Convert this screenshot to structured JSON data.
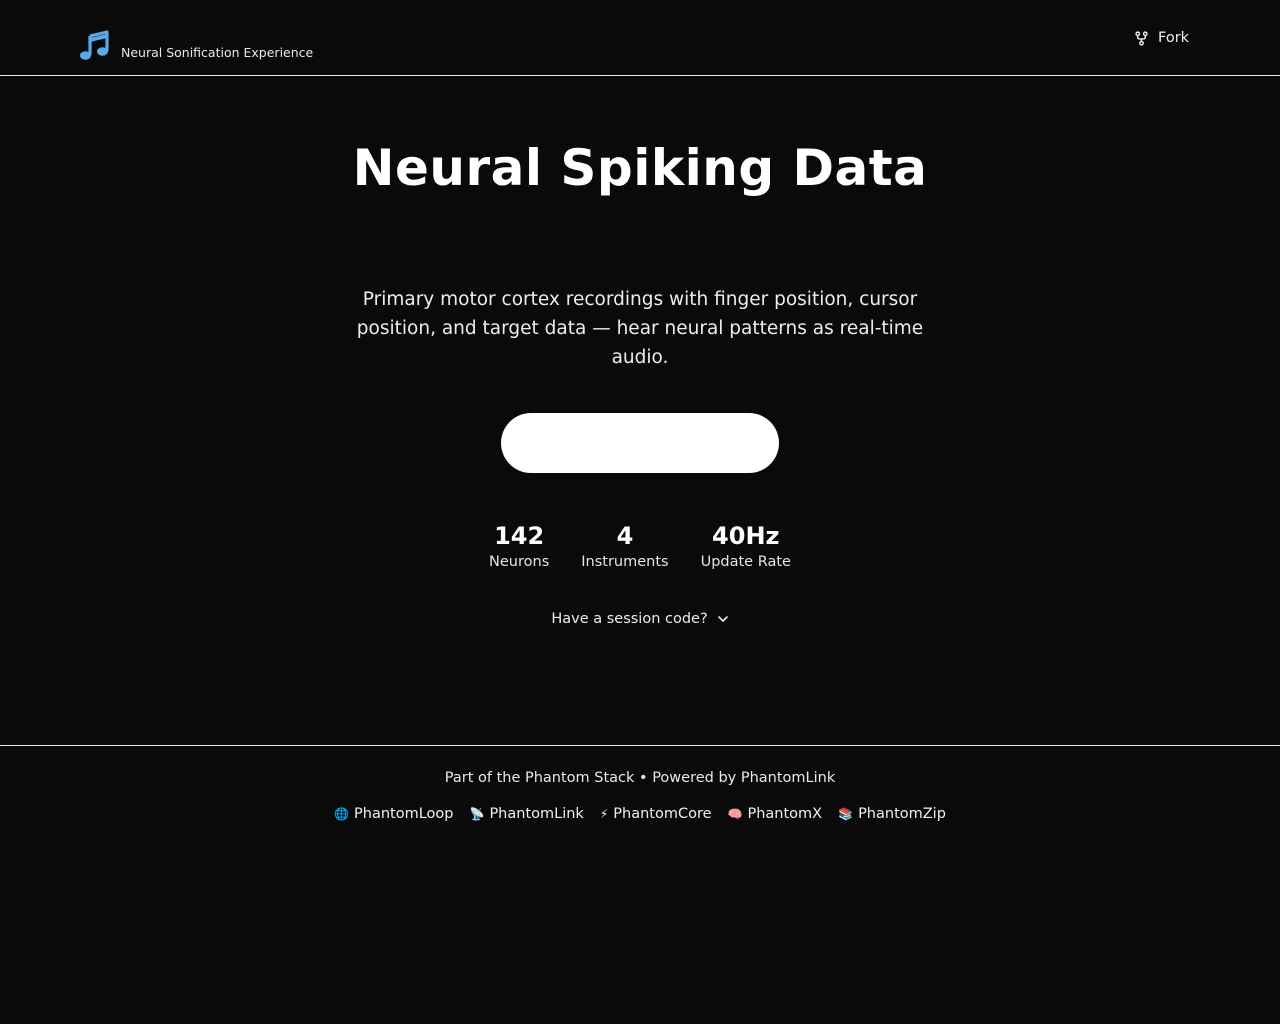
{
  "header": {
    "logo_icon": "music-note-icon",
    "logo_color": "#5aa9e6",
    "tagline": "Neural Sonification Experience",
    "fork_icon": "git-fork-icon",
    "fork_label": "Fork"
  },
  "main": {
    "title": "Neural Spiking Data",
    "description": "Primary motor cortex recordings with finger position, cursor position, and target data — hear neural patterns as real-time audio.",
    "primary_button_label": "",
    "stats": [
      {
        "value": "142",
        "label": "Neurons"
      },
      {
        "value": "4",
        "label": "Instruments"
      },
      {
        "value": "40Hz",
        "label": "Update Rate"
      }
    ],
    "session_toggle_label": "Have a session code?",
    "session_toggle_icon": "chevron-down-icon"
  },
  "footer": {
    "credit_line": "Part of the Phantom Stack • Powered by PhantomLink",
    "links": [
      {
        "emoji": "🌐",
        "icon": "globe-icon",
        "label": "PhantomLoop"
      },
      {
        "emoji": "📡",
        "icon": "satellite-icon",
        "label": "PhantomLink"
      },
      {
        "emoji": "⚡",
        "icon": "lightning-icon",
        "label": "PhantomCore"
      },
      {
        "emoji": "🧠",
        "icon": "brain-icon",
        "label": "PhantomX"
      },
      {
        "emoji": "📚",
        "icon": "books-icon",
        "label": "PhantomZip"
      }
    ]
  },
  "colors": {
    "background": "#0a0a0b",
    "foreground": "#ffffff",
    "accent": "#5aa9e6"
  }
}
